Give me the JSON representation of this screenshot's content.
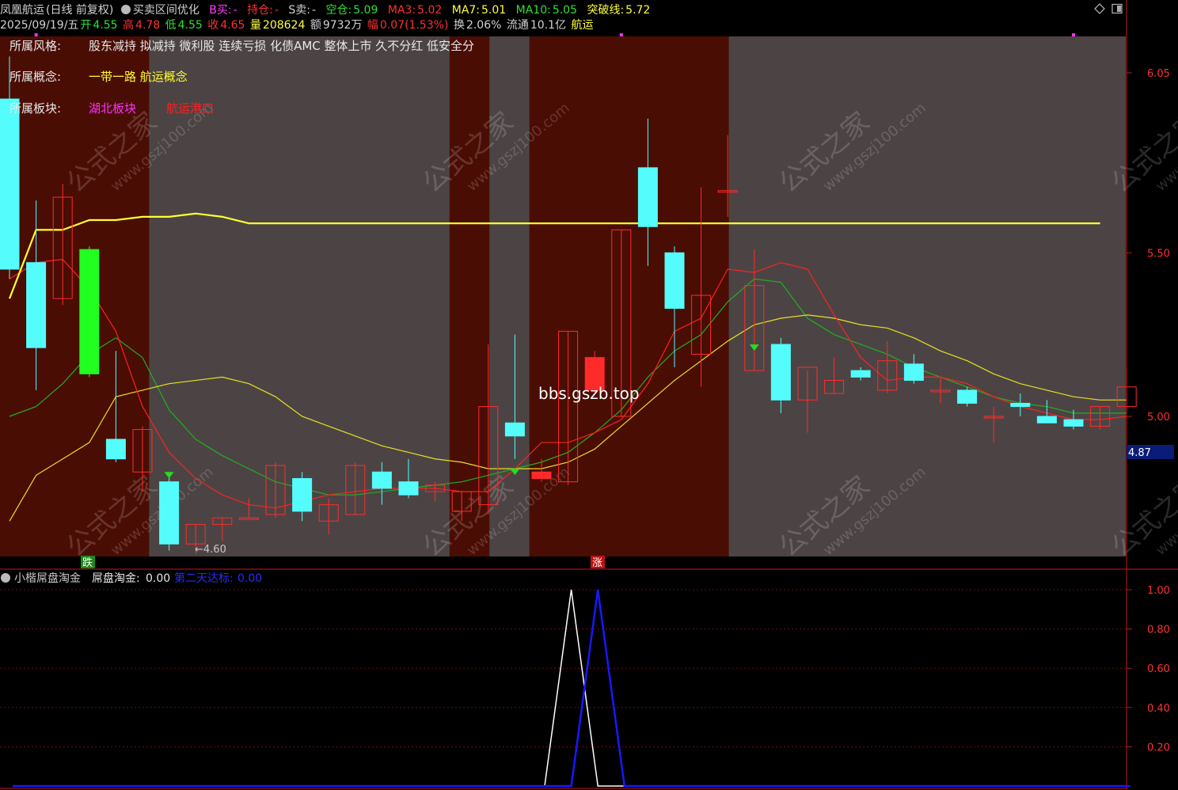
{
  "header": {
    "stock_name": "凤凰航运",
    "mode": "(日线 前复权)",
    "indicator_name": "买卖区间优化",
    "b_buy_label": "B买:",
    "b_buy_value": "-",
    "hold_label": "持仓:",
    "hold_value": "-",
    "s_sell_label": "S卖:",
    "s_sell_value": "-",
    "empty_label": "空仓:",
    "empty_value": "5.09",
    "ma3_label": "MA3:",
    "ma3_value": "5.02",
    "ma7_label": "MA7:",
    "ma7_value": "5.01",
    "ma10_label": "MA10:",
    "ma10_value": "5.05",
    "break_label": "突破线:",
    "break_value": "5.72"
  },
  "quote": {
    "date": "2025/09/19/五",
    "open_label": "开",
    "open": "4.55",
    "high_label": "高",
    "high": "4.78",
    "low_label": "低",
    "low": "4.55",
    "close_label": "收",
    "close": "4.65",
    "vol_label": "量",
    "vol": "208624",
    "amount_label": "额",
    "amount": "9732万",
    "chg_label": "幅",
    "chg": "0.07(1.53%)",
    "turnover_label": "换",
    "turnover": "2.06%",
    "float_label": "流通",
    "float": "10.1亿",
    "sector": "航运"
  },
  "info": {
    "style_label": "所属风格:",
    "style_value": "股东减持 拟减持 微利股 连续亏损 化债AMC 整体上市 久不分红 低安全分",
    "concept_label": "所属概念:",
    "concept_value": "一带一路 航运概念",
    "block_label": "所属板块:",
    "block_value_1": "湖北板块",
    "block_value_2": "航运港口"
  },
  "overlay": {
    "watermark_site": "bbs.gszb.top",
    "watermark_cn": "公式之家",
    "watermark_url": "www.gszj100.com",
    "low_marker": "←4.60",
    "drop_badge": "跌",
    "rise_badge": "涨",
    "price_tag": "4.87"
  },
  "sub_header": {
    "name": "小楷屌盘淘金",
    "s1_label": "屌盘淘金:",
    "s1_value": "0.00",
    "s2_label": "第二天达标:",
    "s2_value": "0.00"
  },
  "colors": {
    "up": "#ff2b2b",
    "down": "#54fcfc",
    "ma3": "#ff2020",
    "ma7": "#e8e020",
    "ma10": "#20b020",
    "break_line": "#ffff30",
    "zone_dark": "#4a0d04",
    "zone_gray": "#4c4444",
    "axis": "#c01818",
    "s1": "#ffffff",
    "s2": "#1818ff"
  },
  "chart_data": [
    {
      "type": "candlestick",
      "y_ticks": [
        6.05,
        5.5,
        5.0
      ],
      "ylim": [
        4.72,
        6.13
      ],
      "candles": [
        {
          "o": 5.97,
          "h": 6.1,
          "l": 5.42,
          "c": 5.45
        },
        {
          "o": 5.47,
          "h": 5.66,
          "l": 5.08,
          "c": 5.21
        },
        {
          "o": 5.36,
          "h": 5.71,
          "l": 5.34,
          "c": 5.67
        },
        {
          "o": 5.51,
          "h": 5.52,
          "l": 5.12,
          "c": 5.13
        },
        {
          "o": 4.93,
          "h": 5.2,
          "l": 4.86,
          "c": 4.87
        },
        {
          "o": 4.83,
          "h": 4.97,
          "l": 4.77,
          "c": 4.96
        },
        {
          "o": 4.8,
          "h": 4.82,
          "l": 4.59,
          "c": 4.61
        },
        {
          "o": 4.61,
          "h": 4.67,
          "l": 4.58,
          "c": 4.67
        },
        {
          "o": 4.67,
          "h": 4.69,
          "l": 4.62,
          "c": 4.69
        },
        {
          "o": 4.69,
          "h": 4.75,
          "l": 4.69,
          "c": 4.69
        },
        {
          "o": 4.7,
          "h": 4.86,
          "l": 4.69,
          "c": 4.85
        },
        {
          "o": 4.81,
          "h": 4.83,
          "l": 4.68,
          "c": 4.71
        },
        {
          "o": 4.68,
          "h": 4.75,
          "l": 4.64,
          "c": 4.73
        },
        {
          "o": 4.7,
          "h": 4.86,
          "l": 4.7,
          "c": 4.85
        },
        {
          "o": 4.83,
          "h": 4.86,
          "l": 4.73,
          "c": 4.78
        },
        {
          "o": 4.8,
          "h": 4.87,
          "l": 4.75,
          "c": 4.76
        },
        {
          "o": 4.77,
          "h": 4.8,
          "l": 4.74,
          "c": 4.79
        },
        {
          "o": 4.71,
          "h": 4.77,
          "l": 4.68,
          "c": 4.77
        },
        {
          "o": 4.73,
          "h": 5.22,
          "l": 4.7,
          "c": 5.03
        },
        {
          "o": 4.98,
          "h": 5.25,
          "l": 4.87,
          "c": 4.94
        },
        {
          "o": 4.83,
          "h": 4.87,
          "l": 4.8,
          "c": 4.81
        },
        {
          "o": 4.8,
          "h": 5.26,
          "l": 4.79,
          "c": 5.26
        },
        {
          "o": 5.18,
          "h": 5.2,
          "l": 5.07,
          "c": 5.08
        },
        {
          "o": 5.0,
          "h": 5.57,
          "l": 5.0,
          "c": 5.57
        },
        {
          "o": 5.76,
          "h": 5.91,
          "l": 5.46,
          "c": 5.58
        },
        {
          "o": 5.5,
          "h": 5.52,
          "l": 5.15,
          "c": 5.33
        },
        {
          "o": 5.19,
          "h": 5.7,
          "l": 5.09,
          "c": 5.37
        },
        {
          "o": 5.69,
          "h": 5.86,
          "l": 5.61,
          "c": 5.69
        },
        {
          "o": 5.14,
          "h": 5.51,
          "l": 5.14,
          "c": 5.4
        },
        {
          "o": 5.22,
          "h": 5.24,
          "l": 5.01,
          "c": 5.05
        },
        {
          "o": 5.05,
          "h": 5.14,
          "l": 4.95,
          "c": 5.15
        },
        {
          "o": 5.07,
          "h": 5.18,
          "l": 5.07,
          "c": 5.11
        },
        {
          "o": 5.14,
          "h": 5.15,
          "l": 5.11,
          "c": 5.12
        },
        {
          "o": 5.08,
          "h": 5.23,
          "l": 5.07,
          "c": 5.17
        },
        {
          "o": 5.16,
          "h": 5.19,
          "l": 5.1,
          "c": 5.11
        },
        {
          "o": 5.08,
          "h": 5.12,
          "l": 5.04,
          "c": 5.08
        },
        {
          "o": 5.08,
          "h": 5.09,
          "l": 5.03,
          "c": 5.04
        },
        {
          "o": 5.0,
          "h": 5.03,
          "l": 4.92,
          "c": 5.0
        },
        {
          "o": 5.04,
          "h": 5.07,
          "l": 5.0,
          "c": 5.03
        },
        {
          "o": 5.0,
          "h": 5.05,
          "l": 4.99,
          "c": 4.98
        },
        {
          "o": 4.99,
          "h": 5.02,
          "l": 4.96,
          "c": 4.97
        },
        {
          "o": 4.97,
          "h": 5.03,
          "l": 4.96,
          "c": 5.03
        },
        {
          "o": 5.03,
          "h": 5.15,
          "l": 5.01,
          "c": 5.09
        }
      ],
      "ma3": [
        5.42,
        5.47,
        5.48,
        5.39,
        5.26,
        5.03,
        4.89,
        4.81,
        4.76,
        4.73,
        4.72,
        4.74,
        4.76,
        4.77,
        4.78,
        4.78,
        4.78,
        4.77,
        4.77,
        4.84,
        4.92,
        4.92,
        4.95,
        4.99,
        5.1,
        5.26,
        5.3,
        5.45,
        5.44,
        5.47,
        5.45,
        5.31,
        5.18,
        5.11,
        5.12,
        5.12,
        5.1,
        5.06,
        5.03,
        5.01,
        4.99,
        4.99,
        5.0
      ],
      "ma7": [
        5.36,
        5.57,
        5.57,
        5.6,
        5.6,
        5.61,
        5.61,
        5.62,
        5.61,
        5.59,
        5.59,
        5.59,
        5.59,
        5.59,
        5.59,
        5.59,
        5.59,
        5.59,
        5.59,
        5.59,
        5.59,
        5.59,
        5.59,
        5.59,
        5.59,
        5.59,
        5.59,
        5.59,
        5.59,
        5.59,
        5.59,
        5.59,
        5.59,
        5.59,
        5.59,
        5.59,
        5.59,
        5.59,
        5.59,
        5.59,
        5.59,
        5.59,
        5.59
      ],
      "ma10": [
        5.0,
        5.03,
        5.1,
        5.19,
        5.24,
        5.18,
        5.02,
        4.93,
        4.88,
        4.84,
        4.8,
        4.78,
        4.76,
        4.76,
        4.77,
        4.78,
        4.79,
        4.8,
        4.82,
        4.84,
        4.86,
        4.89,
        4.95,
        5.02,
        5.12,
        5.2,
        5.25,
        5.35,
        5.42,
        5.41,
        5.3,
        5.25,
        5.22,
        5.19,
        5.15,
        5.12,
        5.09,
        5.06,
        5.04,
        5.03,
        5.01,
        5.01,
        5.01
      ],
      "break_line": [
        4.68,
        4.82,
        4.87,
        4.92,
        5.06,
        5.08,
        5.1,
        5.11,
        5.12,
        5.1,
        5.06,
        5.0,
        4.97,
        4.94,
        4.91,
        4.89,
        4.87,
        4.86,
        4.84,
        4.84,
        4.84,
        4.86,
        4.9,
        4.97,
        5.04,
        5.11,
        5.17,
        5.23,
        5.28,
        5.3,
        5.31,
        5.3,
        5.28,
        5.27,
        5.24,
        5.2,
        5.17,
        5.13,
        5.1,
        5.08,
        5.06,
        5.05,
        5.05
      ]
    },
    {
      "type": "line",
      "y_ticks": [
        1.0,
        0.8,
        0.6,
        0.4,
        0.2
      ],
      "ylim": [
        0,
        1.0
      ],
      "series": [
        {
          "name": "屌盘淘金",
          "values": [
            0,
            0,
            0,
            0,
            0,
            0,
            0,
            0,
            0,
            0,
            0,
            0,
            0,
            0,
            0,
            0,
            0,
            0,
            0,
            0,
            0,
            1,
            0,
            0,
            0,
            0,
            0,
            0,
            0,
            0,
            0,
            0,
            0,
            0,
            0,
            0,
            0,
            0,
            0,
            0,
            0,
            0,
            0
          ]
        },
        {
          "name": "第二天达标",
          "values": [
            0,
            0,
            0,
            0,
            0,
            0,
            0,
            0,
            0,
            0,
            0,
            0,
            0,
            0,
            0,
            0,
            0,
            0,
            0,
            0,
            0,
            0,
            1,
            0,
            0,
            0,
            0,
            0,
            0,
            0,
            0,
            0,
            0,
            0,
            0,
            0,
            0,
            0,
            0,
            0,
            0,
            0,
            0
          ]
        }
      ]
    }
  ]
}
